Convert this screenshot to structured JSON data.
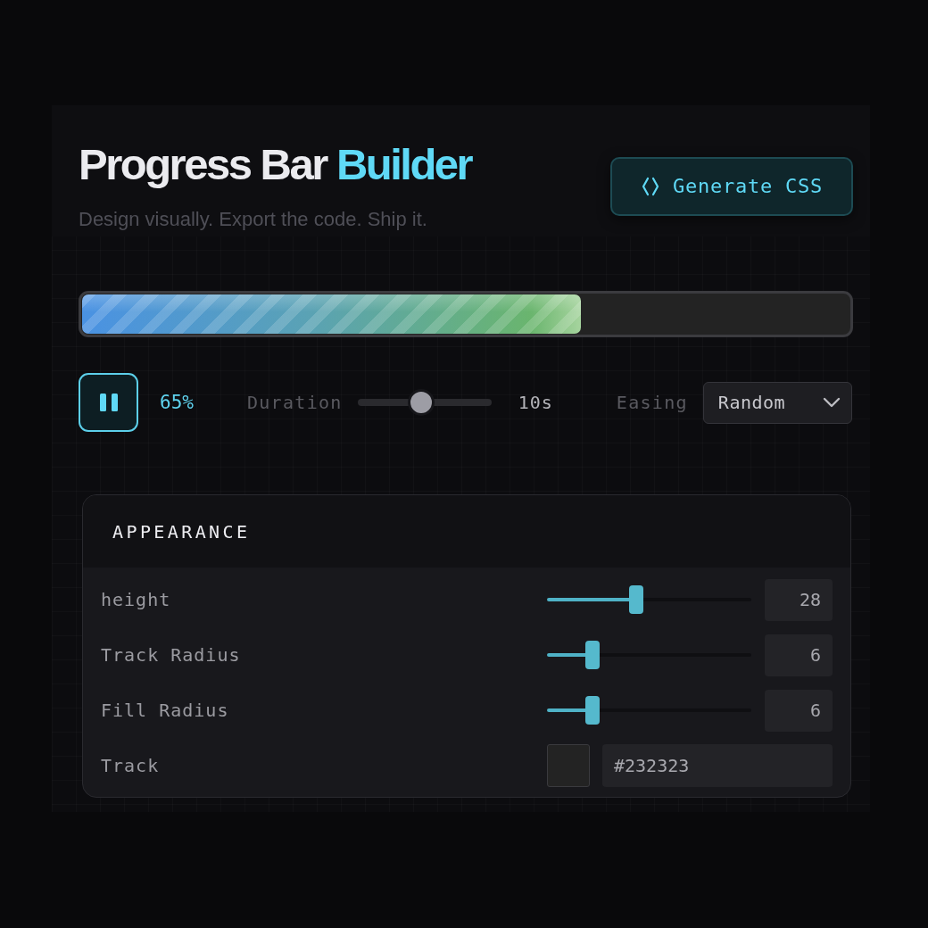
{
  "header": {
    "title": "Progress Bar",
    "title_accent": "Builder",
    "subtitle": "Design visually. Export the code. Ship it.",
    "action": "Generate CSS"
  },
  "preview": {
    "level": 0.65
  },
  "controls": {
    "playing": true,
    "percent": "65%",
    "duration": {
      "label": "Duration",
      "level": 0.47,
      "value": "10s"
    },
    "easing": {
      "label": "Easing",
      "value": "Random"
    }
  },
  "appearance": {
    "title": "APPEARANCE",
    "rows": [
      {
        "kind": "slider",
        "label": "height",
        "level": 0.43,
        "value": "28"
      },
      {
        "kind": "slider",
        "label": "Track Radius",
        "level": 0.2,
        "value": "6"
      },
      {
        "kind": "slider",
        "label": "Fill Radius",
        "level": 0.2,
        "value": "6"
      },
      {
        "kind": "color",
        "label": "Track",
        "color": "#232323",
        "value": "#232323"
      }
    ]
  }
}
